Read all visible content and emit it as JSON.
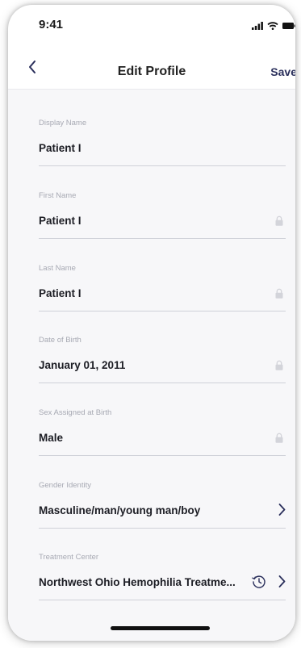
{
  "status_bar": {
    "time": "9:41",
    "icons": [
      "signal-icon",
      "wifi-icon",
      "battery-icon"
    ]
  },
  "nav": {
    "back_icon": "chevron-left-icon",
    "title": "Edit Profile",
    "save_label": "Save"
  },
  "fields": [
    {
      "label": "Display Name",
      "value": "Patient I",
      "locked": false
    },
    {
      "label": "First Name",
      "value": "Patient I",
      "locked": true
    },
    {
      "label": "Last Name",
      "value": "Patient I",
      "locked": true
    },
    {
      "label": "Date of Birth",
      "value": "January 01, 2011",
      "locked": true
    },
    {
      "label": "Sex Assigned at Birth",
      "value": "Male",
      "locked": true
    },
    {
      "label": "Gender Identity",
      "value": "Masculine/man/young man/boy",
      "action": "chevron-right-icon"
    },
    {
      "label": "Treatment Center",
      "value": "Northwest Ohio Hemophilia Treatme...",
      "action": "chevron-right-icon",
      "secondary_icon": "history-clock-icon"
    }
  ],
  "colors": {
    "accent": "#2a2f5b",
    "background": "#f7f7f9",
    "label": "#a7a9b3",
    "value": "#1c1d24",
    "divider": "#cfd1d8"
  }
}
